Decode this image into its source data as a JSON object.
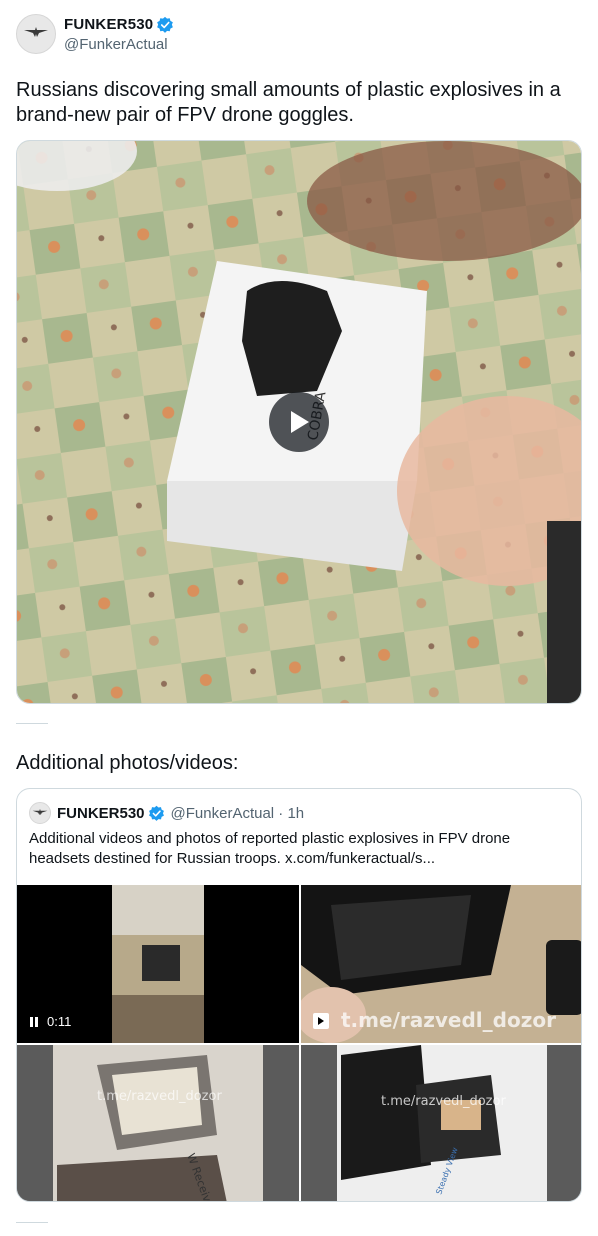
{
  "author": {
    "display_name": "FUNKER530",
    "handle": "@FunkerActual",
    "avatar_icon": "funker-logo-icon",
    "verified_icon": "verified-badge-icon",
    "verified_color": "#1d9bf0"
  },
  "tweet": {
    "text": "Russians discovering small amounts of plastic explosives in a brand-new pair of FPV drone goggles.",
    "media": {
      "type": "video",
      "box_text": "COBRA",
      "play_icon": "play-icon"
    }
  },
  "section": {
    "title": "Additional photos/videos:"
  },
  "quoted_tweet": {
    "display_name": "FUNKER530",
    "handle_time": "@FunkerActual · 1h",
    "text": "Additional videos and photos of reported plastic explosives in FPV drone headsets destined for Russian troops.  x.com/funkeractual/s...",
    "media": [
      {
        "kind": "video",
        "duration": "0:11",
        "icon": "pause-icon"
      },
      {
        "kind": "gif",
        "watermark": "t.me/razvedl_dozor",
        "icon": "play-icon"
      },
      {
        "kind": "photo",
        "watermark": "t.me/razvedl_dozor",
        "caption": "W Receiver"
      },
      {
        "kind": "photo",
        "watermark": "t.me/razvedl_dozor",
        "caption": "Steady View"
      }
    ]
  },
  "colors": {
    "text": "#0f1419",
    "secondary": "#536471",
    "border": "#cfd9de",
    "accent": "#1d9bf0"
  }
}
